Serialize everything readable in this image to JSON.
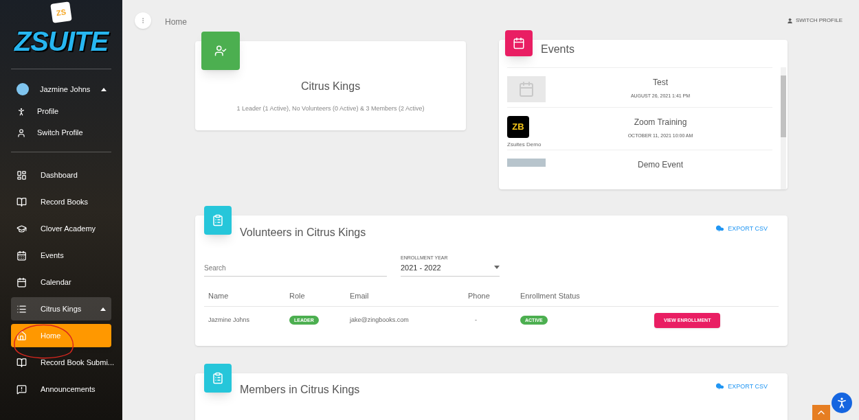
{
  "sidebar": {
    "logo": {
      "badge": "ZS",
      "wordmark": "ZSUITE"
    },
    "user": {
      "name": "Jazmine Johns",
      "expanded": true,
      "items": [
        {
          "label": "Profile"
        },
        {
          "label": "Switch Profile"
        }
      ]
    },
    "nav": [
      {
        "label": "Dashboard",
        "selected": false
      },
      {
        "label": "Record Books",
        "selected": false
      },
      {
        "label": "Clover Academy",
        "selected": false
      },
      {
        "label": "Events",
        "selected": false
      },
      {
        "label": "Calendar",
        "selected": false
      },
      {
        "label": "Citrus Kings",
        "selected": false,
        "expanded": true,
        "children": [
          {
            "label": "Home",
            "selected": true
          },
          {
            "label": "Record Book Submi...",
            "selected": false
          },
          {
            "label": "Announcements",
            "selected": false
          }
        ]
      }
    ]
  },
  "topbar": {
    "title": "Home",
    "switch_profile": "SWITCH PROFILE"
  },
  "club_card": {
    "title": "Citrus Kings",
    "summary": "1 Leader (1 Active), No Volunteers (0 Active) & 3 Members (2 Active)"
  },
  "events": {
    "title": "Events",
    "items": [
      {
        "kind": "placeholder",
        "title": "Test",
        "date": "AUGUST 26, 2021 1:41 PM"
      },
      {
        "kind": "logo",
        "logo_text": "ZB",
        "caption": "Zsuites Demo",
        "title": "Zoom Training",
        "date": "OCTOBER 11, 2021 10:00 AM"
      },
      {
        "kind": "photo",
        "title": "Demo Event"
      }
    ]
  },
  "volunteers": {
    "title": "Volunteers in Citrus Kings",
    "export": "EXPORT CSV",
    "search": {
      "placeholder": "Search"
    },
    "enrollment_year": {
      "label": "ENROLLMENT YEAR",
      "value": "2021 - 2022"
    },
    "columns": [
      "Name",
      "Role",
      "Email",
      "Phone",
      "Enrollment Status"
    ],
    "rows": [
      {
        "name": "Jazmine Johns",
        "role": "LEADER",
        "email": "jake@zingbooks.com",
        "phone": "-",
        "status": "ACTIVE",
        "action": "VIEW ENROLLMENT"
      }
    ]
  },
  "members": {
    "title": "Members in Citrus Kings",
    "export": "EXPORT CSV"
  }
}
